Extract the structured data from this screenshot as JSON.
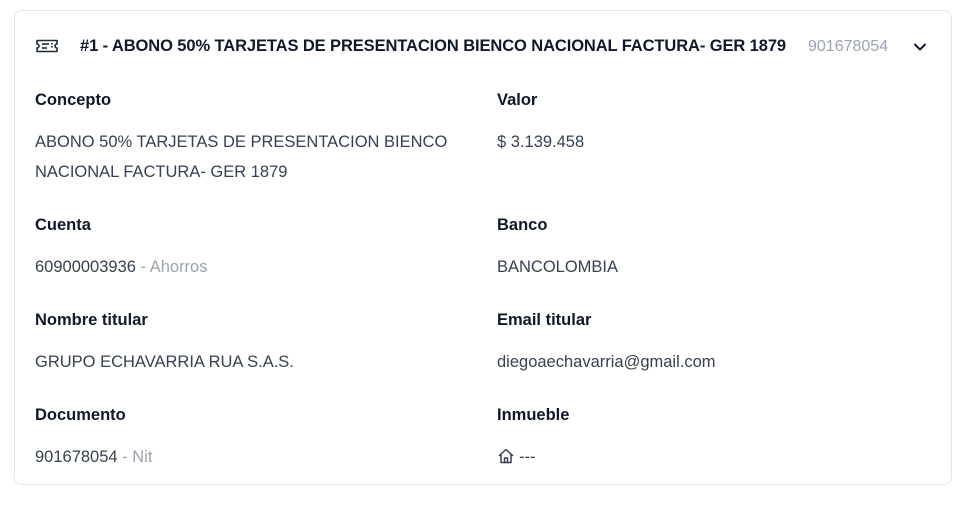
{
  "header": {
    "icon": "ticket-icon",
    "title": "#1 - ABONO 50% TARJETAS DE PRESENTACION BIENCO NACIONAL FACTURA- GER 1879",
    "document": "901678054",
    "toggle_icon": "chevron-down-icon"
  },
  "fields": {
    "concepto": {
      "label": "Concepto",
      "value": "ABONO 50% TARJETAS DE PRESENTACION BIENCO NACIONAL FACTURA- GER 1879"
    },
    "valor": {
      "label": "Valor",
      "value": "$ 3.139.458"
    },
    "cuenta": {
      "label": "Cuenta",
      "number": "60900003936",
      "type": " - Ahorros"
    },
    "banco": {
      "label": "Banco",
      "value": "BANCOLOMBIA"
    },
    "nombre_titular": {
      "label": "Nombre titular",
      "value": "GRUPO ECHAVARRIA RUA S.A.S."
    },
    "email_titular": {
      "label": "Email titular",
      "value": "diegoaechavarria@gmail.com"
    },
    "documento": {
      "label": "Documento",
      "number": "901678054",
      "type": " - Nit"
    },
    "inmueble": {
      "label": "Inmueble",
      "icon": "home-icon",
      "value": "---"
    }
  },
  "colors": {
    "title": "#111827",
    "text": "#374151",
    "muted": "#9ca3af",
    "border": "#e5e7eb"
  }
}
